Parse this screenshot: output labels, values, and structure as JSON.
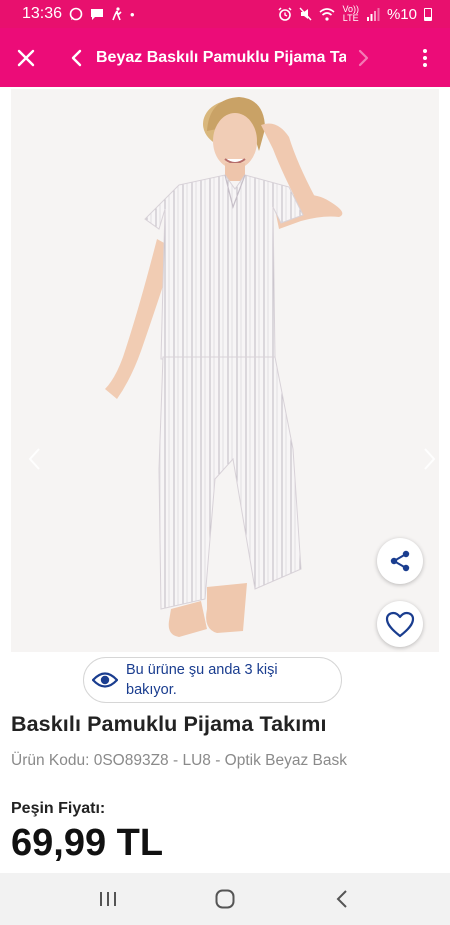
{
  "status_bar": {
    "time": "13:36",
    "dot": "•",
    "network_label_top": "Vo))",
    "network_label_bottom": "LTE",
    "battery": "%10"
  },
  "app_bar": {
    "title": "Beyaz Baskılı Pamuklu Pijama Ta...",
    "close_icon": "close-icon",
    "back_icon": "chevron-left-icon",
    "forward_icon": "chevron-right-icon",
    "menu_icon": "more-vert-icon"
  },
  "gallery": {
    "prev_icon": "chevron-left-icon",
    "next_icon": "chevron-right-icon",
    "share_icon": "share-icon",
    "favorite_icon": "heart-icon"
  },
  "viewers": {
    "text": "Bu ürüne şu anda 3 kişi bakıyor.",
    "icon": "eye-icon"
  },
  "product": {
    "title": "Baskılı Pamuklu Pijama Takımı",
    "code": "Ürün Kodu: 0SO893Z8 - LU8 - Optik Beyaz Bask",
    "price_label": "Peşin Fiyatı:",
    "price": "69,99 TL"
  },
  "colors": {
    "brand": "#ec0c78",
    "status_bar": "#e8106e",
    "accent_blue": "#1a3d8f"
  }
}
